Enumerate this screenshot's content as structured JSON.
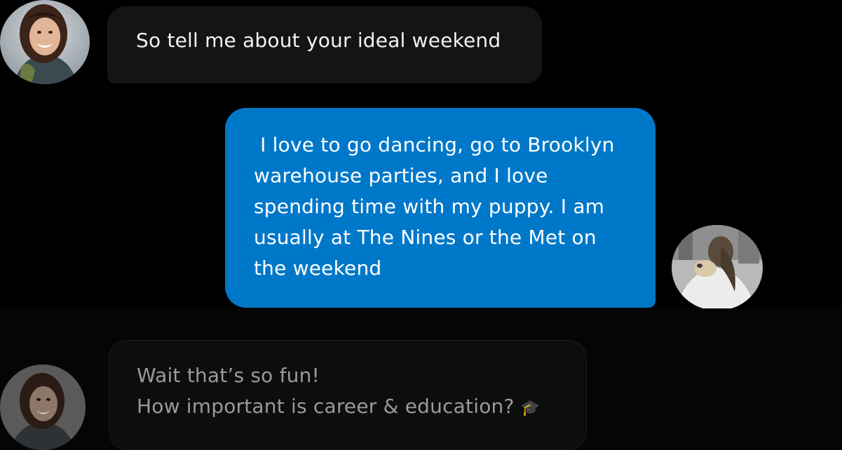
{
  "conversation": {
    "messages": [
      {
        "sender": "match",
        "lines": [
          "So tell me about your ideal weekend"
        ]
      },
      {
        "sender": "user",
        "lines": [
          " I love to go dancing, go to Brooklyn",
          "warehouse parties, and I love",
          "spending time with my puppy. I am",
          "usually at The Nines or the Met on",
          "the weekend"
        ]
      },
      {
        "sender": "match",
        "lines": [
          "Wait that’s so fun!",
          "How important is career & education?"
        ],
        "emoji": "🎓"
      }
    ]
  },
  "colors": {
    "background": "#000000",
    "incoming_bubble": "#141414",
    "outgoing_bubble": "#0078c9",
    "dim_bubble": "#0d0d0d"
  },
  "icons": {
    "graduation": "graduation-cap-icon"
  }
}
